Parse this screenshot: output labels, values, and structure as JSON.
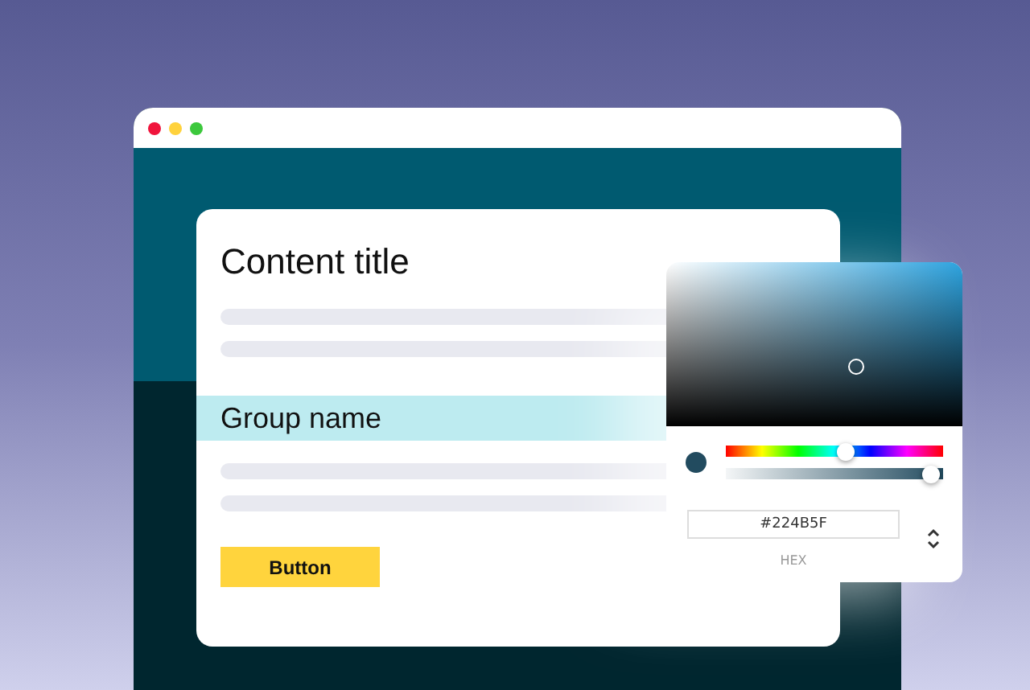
{
  "card": {
    "title": "Content title",
    "group_name": "Group name",
    "button": "Button"
  },
  "color_picker": {
    "hue": {
      "level": 0.56
    },
    "opacity": {
      "level": 0.98
    },
    "hex_value": "#224B5F",
    "format_label": "HEX"
  }
}
